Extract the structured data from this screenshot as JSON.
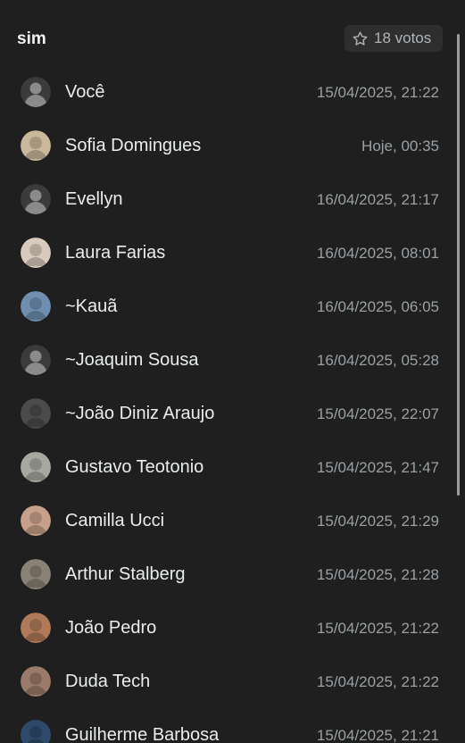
{
  "header": {
    "option_title": "sim",
    "votes_label": "18 votos"
  },
  "voters": [
    {
      "name": "Você",
      "time": "15/04/2025, 21:22",
      "avatar": "default-avatar-icon",
      "color": "#8696a0"
    },
    {
      "name": "Sofia Domingues",
      "time": "Hoje, 00:35",
      "avatar": "photo",
      "color": "#c9b99a"
    },
    {
      "name": "Evellyn",
      "time": "16/04/2025, 21:17",
      "avatar": "default-avatar-icon",
      "color": "#8696a0"
    },
    {
      "name": "Laura Farias",
      "time": "16/04/2025, 08:01",
      "avatar": "photo",
      "color": "#d8cbbd"
    },
    {
      "name": "~Kauã",
      "time": "16/04/2025, 06:05",
      "avatar": "photo",
      "color": "#6f8fb0"
    },
    {
      "name": "~Joaquim Sousa",
      "time": "16/04/2025, 05:28",
      "avatar": "default-avatar-icon",
      "color": "#8696a0"
    },
    {
      "name": "~João Diniz Araujo",
      "time": "15/04/2025, 22:07",
      "avatar": "photo",
      "color": "#4b4b4b"
    },
    {
      "name": "Gustavo Teotonio",
      "time": "15/04/2025, 21:47",
      "avatar": "photo",
      "color": "#a8a8a0"
    },
    {
      "name": "Camilla Ucci",
      "time": "15/04/2025, 21:29",
      "avatar": "photo",
      "color": "#c7a08a"
    },
    {
      "name": "Arthur Stalberg",
      "time": "15/04/2025, 21:28",
      "avatar": "photo",
      "color": "#8a8276"
    },
    {
      "name": "João Pedro",
      "time": "15/04/2025, 21:22",
      "avatar": "photo",
      "color": "#b07a5a"
    },
    {
      "name": "Duda Tech",
      "time": "15/04/2025, 21:22",
      "avatar": "photo",
      "color": "#9a7a68"
    },
    {
      "name": "Guilherme Barbosa",
      "time": "15/04/2025, 21:21",
      "avatar": "photo",
      "color": "#2e4a6a"
    }
  ],
  "colors": {
    "background": "#1f1f1f",
    "badge_bg": "#2e2e2e",
    "text_primary": "#e9edef",
    "text_secondary": "#9aa0a4"
  }
}
